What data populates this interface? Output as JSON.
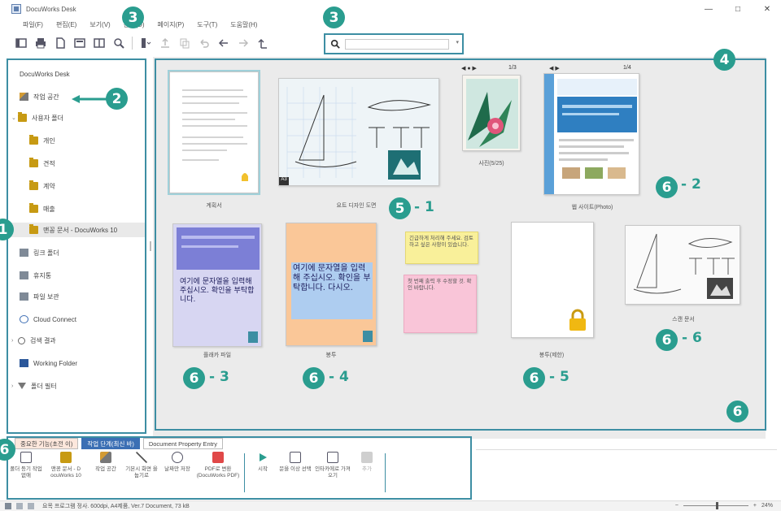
{
  "window": {
    "title": "DocuWorks Desk"
  },
  "menus": [
    "파일(F)",
    "편집(E)",
    "보기(V)",
    "문서(D)",
    "페이지(P)",
    "도구(T)",
    "도움말(H)"
  ],
  "search": {
    "placeholder": "",
    "value": ""
  },
  "sidebar": {
    "items": [
      {
        "label": "DocuWorks Desk"
      },
      {
        "label": "작업 공간"
      },
      {
        "label": "사용자 폴더"
      },
      {
        "label": "개인"
      },
      {
        "label": "견적"
      },
      {
        "label": "계약"
      },
      {
        "label": "매출"
      },
      {
        "label": "맨꽁 문서 - DocuWorks 10"
      },
      {
        "label": "링크 폴더"
      },
      {
        "label": "휴지통"
      },
      {
        "label": "파일 보관"
      },
      {
        "label": "Cloud Connect"
      },
      {
        "label": "검색 결과"
      },
      {
        "label": "Working Folder"
      },
      {
        "label": "폴더 필터"
      }
    ]
  },
  "documents": [
    {
      "caption": "계획서"
    },
    {
      "caption": "요트 디자인 도면"
    },
    {
      "caption": "사진(5/25)",
      "pager": "1/3"
    },
    {
      "caption": "웹 사이트(Photo)",
      "pager": "1/4"
    },
    {
      "caption": "플래카 파일"
    },
    {
      "caption": "봉투"
    },
    {
      "caption": ""
    },
    {
      "caption": "봉투(제한)"
    },
    {
      "caption": "스캔 문서"
    }
  ],
  "sticky_notes": [
    "긴급하게 처리해 주세요. 검토하고 싶은 사항이 있습니다.",
    "첫 번째 출력 후 수정할 것. 확인 바랍니다."
  ],
  "doc_texts": {
    "flyer": "여기에 문자열을 입력해 주십시오. 확인을 부탁합니다.",
    "envelope": "여기에 문자열을 입력해 주십시오. 확인을 부탁합니다. 다시오."
  },
  "ribbon": {
    "tabs": [
      "중요한 기능(초전 이)",
      "작업 단계(최신 바)",
      "Document Property Entry"
    ],
    "buttons": [
      "폴더 등기 작업 없애",
      "맨꽁 문서 - D ocuWorks 10",
      "작업 공간",
      "기본시 화면 을 눕기로",
      "날짜만 저장",
      "PDF로 변환(DocuWorks PDF)",
      "시작",
      "문을 이상 선택",
      "인타카에로 가져오기",
      "추가"
    ]
  },
  "status": {
    "text": "요목 프로그램 정사. 600dpi, A4제품, Ver.7 Document, 73 kB",
    "zoom": "24%"
  },
  "annotations": [
    "1",
    "2",
    "3",
    "3",
    "4",
    "5",
    "6",
    "6",
    "6",
    "6",
    "6",
    "6",
    "6"
  ],
  "annotation_labels": [
    "- 1",
    "- 2",
    "- 3",
    "- 4",
    "- 5",
    "- 6"
  ],
  "colors": {
    "accent": "#2a9d8f",
    "outline": "#3d8ea3",
    "tab_active": "#3b6fb4"
  }
}
